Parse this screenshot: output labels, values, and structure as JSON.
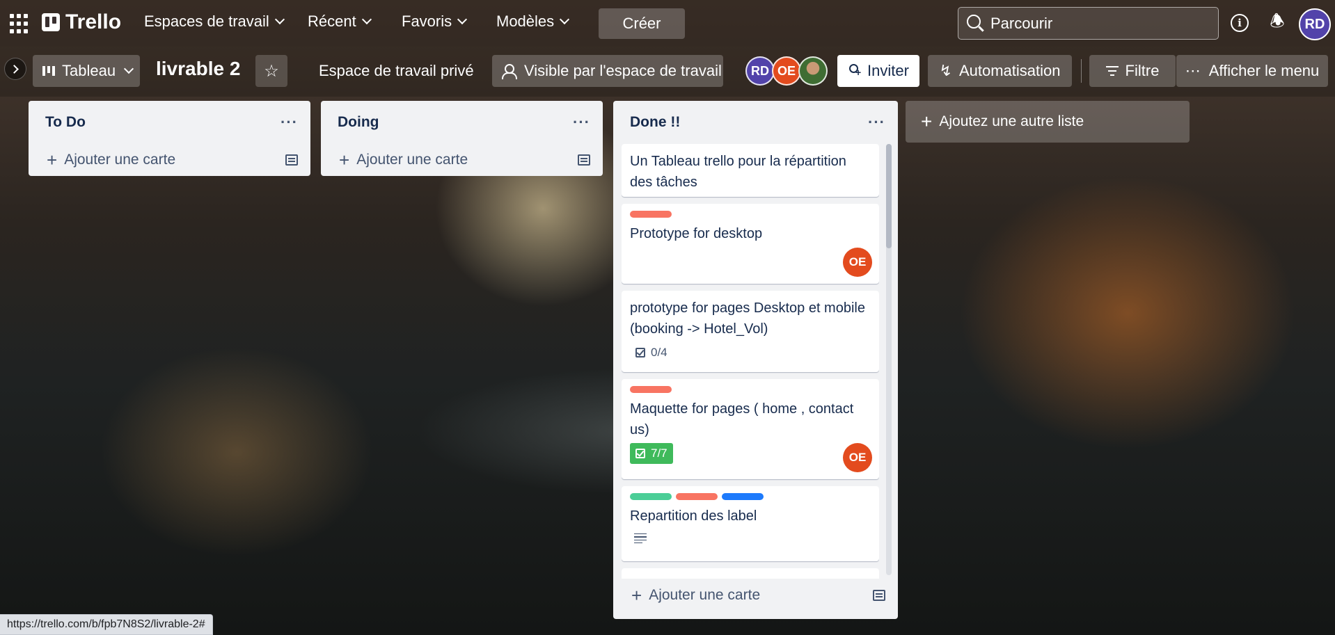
{
  "topbar": {
    "logo": "Trello",
    "menus": [
      "Espaces de travail",
      "Récent",
      "Favoris",
      "Modèles"
    ],
    "create": "Créer",
    "search_placeholder": "Parcourir",
    "user_initials": "RD"
  },
  "boardbar": {
    "view": "Tableau",
    "title": "livrable 2",
    "workspace": "Espace de travail privé",
    "visibility": "Visible par l'espace de travail",
    "members": [
      "RD",
      "OE"
    ],
    "invite": "Inviter",
    "automation": "Automatisation",
    "filter": "Filtre",
    "show_menu": "Afficher le menu"
  },
  "lists": [
    {
      "title": "To Do",
      "add_card": "Ajouter une carte"
    },
    {
      "title": "Doing",
      "add_card": "Ajouter une carte"
    },
    {
      "title": "Done !!",
      "add_card": "Ajouter une carte",
      "cards": [
        {
          "title": "Un Tableau trello pour la répartition des tâches"
        },
        {
          "title": "Prototype for desktop",
          "labels": [
            "red"
          ],
          "member": "OE"
        },
        {
          "title": "prototype for pages Desktop et mobile (booking -> Hotel_Vol)",
          "checklist": "0/4"
        },
        {
          "title": "Maquette for pages ( home , contact us)",
          "labels": [
            "red"
          ],
          "checklist": "7/7",
          "member": "OE"
        },
        {
          "title": "Repartition des label",
          "labels": [
            "green",
            "red",
            "blue"
          ]
        }
      ]
    }
  ],
  "add_list": "Ajoutez une autre liste",
  "status_url": "https://trello.com/b/fpb7N8S2/livrable-2#",
  "colors": {
    "label_red": "#f87462",
    "label_green": "#4bce97",
    "label_blue": "#1d7afc",
    "member_oe": "#e34b1e",
    "member_rd": "#5243aa",
    "checklist_done": "#3fba5b"
  }
}
